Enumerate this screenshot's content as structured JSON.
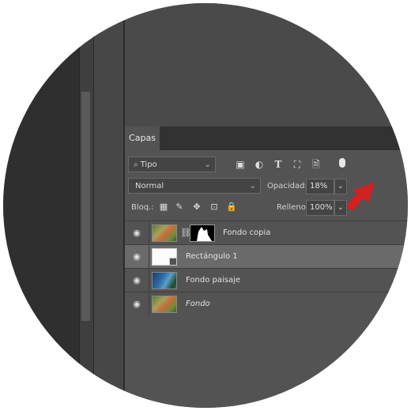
{
  "panel": {
    "tab_label": "Capas"
  },
  "filter_row": {
    "kind_label": "Tipo",
    "icons": [
      "image-filter-icon",
      "adjustment-filter-icon",
      "type-filter-icon",
      "shape-filter-icon",
      "smart-object-filter-icon"
    ]
  },
  "blend_row": {
    "mode": "Normal",
    "opacity_label": "Opacidad:",
    "opacity_value": "18%"
  },
  "lock_row": {
    "lock_label": "Bloq.:",
    "fill_label": "Relleno:",
    "fill_value": "100%"
  },
  "layers": [
    {
      "name": "Fondo copia",
      "has_mask": true,
      "selected": false
    },
    {
      "name": "Rectángulo 1",
      "shape": true,
      "selected": true
    },
    {
      "name": "Fondo paisaje",
      "selected": false
    },
    {
      "name": "Fondo",
      "italic": true,
      "selected": false
    }
  ],
  "colors": {
    "panel_bg": "#535353",
    "selected_row": "#6a6a6a",
    "annotation_arrow": "#d32020"
  }
}
